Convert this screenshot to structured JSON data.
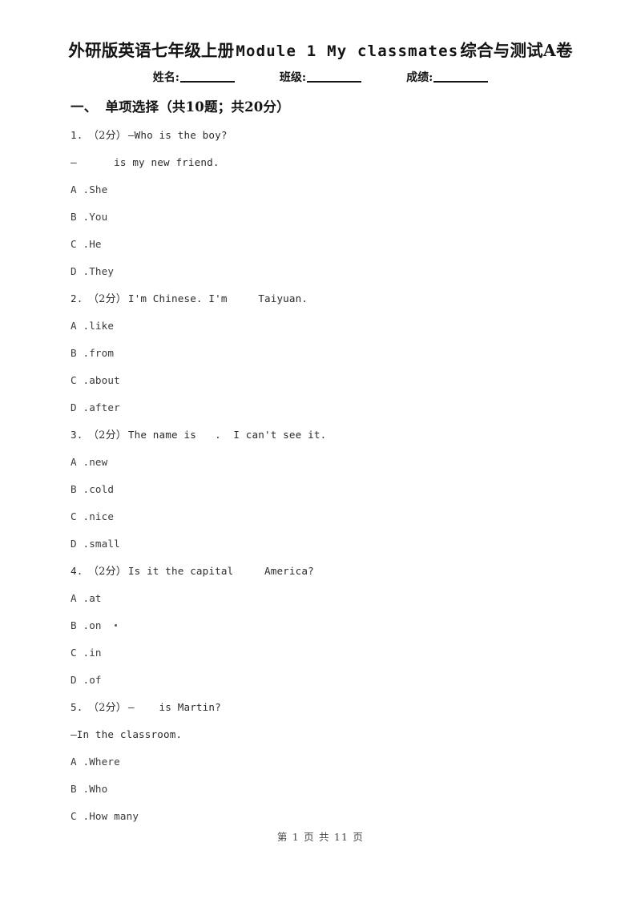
{
  "document": {
    "title_cn_prefix": "外研版英语七年级上册",
    "title_en": "Module 1 My classmates",
    "title_cn_suffix": "综合与测试A卷",
    "title_full": "外研版英语七年级上册Module 1 My classmates综合与测试A卷"
  },
  "info": {
    "name_label": "姓名:",
    "class_label": "班级:",
    "score_label": "成绩:"
  },
  "section": {
    "number": "一、",
    "title": "单项选择（共10题；共20分）"
  },
  "questions": [
    {
      "number": "1.",
      "marks": "（2分）",
      "stem": "—Who is the boy?",
      "continuation": "—      is my new friend.",
      "options": [
        {
          "key": "A .",
          "text": "She"
        },
        {
          "key": "B .",
          "text": "You"
        },
        {
          "key": "C .",
          "text": "He"
        },
        {
          "key": "D .",
          "text": "They"
        }
      ]
    },
    {
      "number": "2.",
      "marks": "（2分）",
      "stem": "I'm Chinese. I'm     Taiyuan.",
      "continuation": null,
      "options": [
        {
          "key": "A .",
          "text": "like"
        },
        {
          "key": "B .",
          "text": "from"
        },
        {
          "key": "C .",
          "text": "about"
        },
        {
          "key": "D .",
          "text": "after"
        }
      ]
    },
    {
      "number": "3.",
      "marks": "（2分）",
      "stem": "The name is   .  I can't see it.",
      "continuation": null,
      "options": [
        {
          "key": "A .",
          "text": "new"
        },
        {
          "key": "B .",
          "text": "cold"
        },
        {
          "key": "C .",
          "text": "nice"
        },
        {
          "key": "D .",
          "text": "small"
        }
      ]
    },
    {
      "number": "4.",
      "marks": "（2分）",
      "stem": "Is it the capital     America?",
      "continuation": null,
      "options": [
        {
          "key": "A .",
          "text": "at"
        },
        {
          "key": "B .",
          "text": "on"
        },
        {
          "key": "C .",
          "text": "in"
        },
        {
          "key": "D .",
          "text": "of"
        }
      ]
    },
    {
      "number": "5.",
      "marks": "（2分）",
      "stem": "—    is Martin?",
      "continuation": "—In the classroom.",
      "options": [
        {
          "key": "A .",
          "text": "Where"
        },
        {
          "key": "B .",
          "text": "Who"
        },
        {
          "key": "C .",
          "text": "How many"
        }
      ]
    }
  ],
  "footer": {
    "text": "第 1 页  共 11 页"
  }
}
